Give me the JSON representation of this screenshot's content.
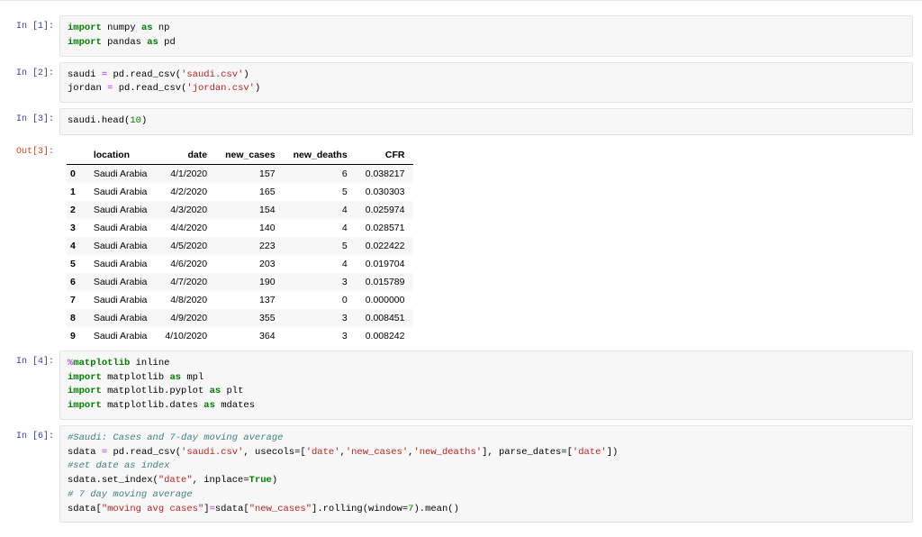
{
  "cells": {
    "c1": {
      "prompt": "In [1]:"
    },
    "c2": {
      "prompt": "In [2]:"
    },
    "c3": {
      "prompt": "In [3]:"
    },
    "c3out": {
      "prompt": "Out[3]:"
    },
    "c4": {
      "prompt": "In [4]:"
    },
    "c6": {
      "prompt": "In [6]:"
    }
  },
  "tokens": {
    "import": "import",
    "as": "as",
    "numpy": "numpy",
    "np": "np",
    "pandas": "pandas",
    "pd": "pd",
    "saudi_var": "saudi",
    "jordan_var": "jordan",
    "eq": "=",
    "read_csv": ".read_csv(",
    "close_paren": ")",
    "str_saudi_csv": "'saudi.csv'",
    "str_jordan_csv": "'jordan.csv'",
    "head_call": ".head(",
    "ten": "10",
    "magic": "%",
    "matplotlib_word": "matplotlib",
    "inline": " inline",
    "mpl": "mpl",
    "mpl_pyplot": "matplotlib.pyplot",
    "plt": "plt",
    "mpl_dates": "matplotlib.dates",
    "mdates": "mdates",
    "comment1": "#Saudi: Cases and 7-day moving average",
    "sdata": "sdata",
    "usecols": ", usecols=[",
    "str_date": "'date'",
    "comma": ",",
    "str_new_cases": "'new_cases'",
    "str_new_deaths": "'new_deaths'",
    "rb": "]",
    "parse_dates": ", parse_dates=[",
    "comment2": "#set date as index",
    "set_index": ".set_index(",
    "str_date2": "\"date\"",
    "inplace": ", inplace=",
    "true": "True",
    "comment3": "# 7 day moving average",
    "lb": "[",
    "str_mavg": "\"moving avg cases\"",
    "rb2": "]",
    "eq2": "=",
    "str_new_cases2": "\"new_cases\"",
    "rolling": ".rolling(window=",
    "seven": "7",
    "mean": ").mean()"
  },
  "table": {
    "columns": [
      "",
      "location",
      "date",
      "new_cases",
      "new_deaths",
      "CFR"
    ],
    "rows": [
      [
        "0",
        "Saudi Arabia",
        "4/1/2020",
        "157",
        "6",
        "0.038217"
      ],
      [
        "1",
        "Saudi Arabia",
        "4/2/2020",
        "165",
        "5",
        "0.030303"
      ],
      [
        "2",
        "Saudi Arabia",
        "4/3/2020",
        "154",
        "4",
        "0.025974"
      ],
      [
        "3",
        "Saudi Arabia",
        "4/4/2020",
        "140",
        "4",
        "0.028571"
      ],
      [
        "4",
        "Saudi Arabia",
        "4/5/2020",
        "223",
        "5",
        "0.022422"
      ],
      [
        "5",
        "Saudi Arabia",
        "4/6/2020",
        "203",
        "4",
        "0.019704"
      ],
      [
        "6",
        "Saudi Arabia",
        "4/7/2020",
        "190",
        "3",
        "0.015789"
      ],
      [
        "7",
        "Saudi Arabia",
        "4/8/2020",
        "137",
        "0",
        "0.000000"
      ],
      [
        "8",
        "Saudi Arabia",
        "4/9/2020",
        "355",
        "3",
        "0.008451"
      ],
      [
        "9",
        "Saudi Arabia",
        "4/10/2020",
        "364",
        "3",
        "0.008242"
      ]
    ]
  }
}
